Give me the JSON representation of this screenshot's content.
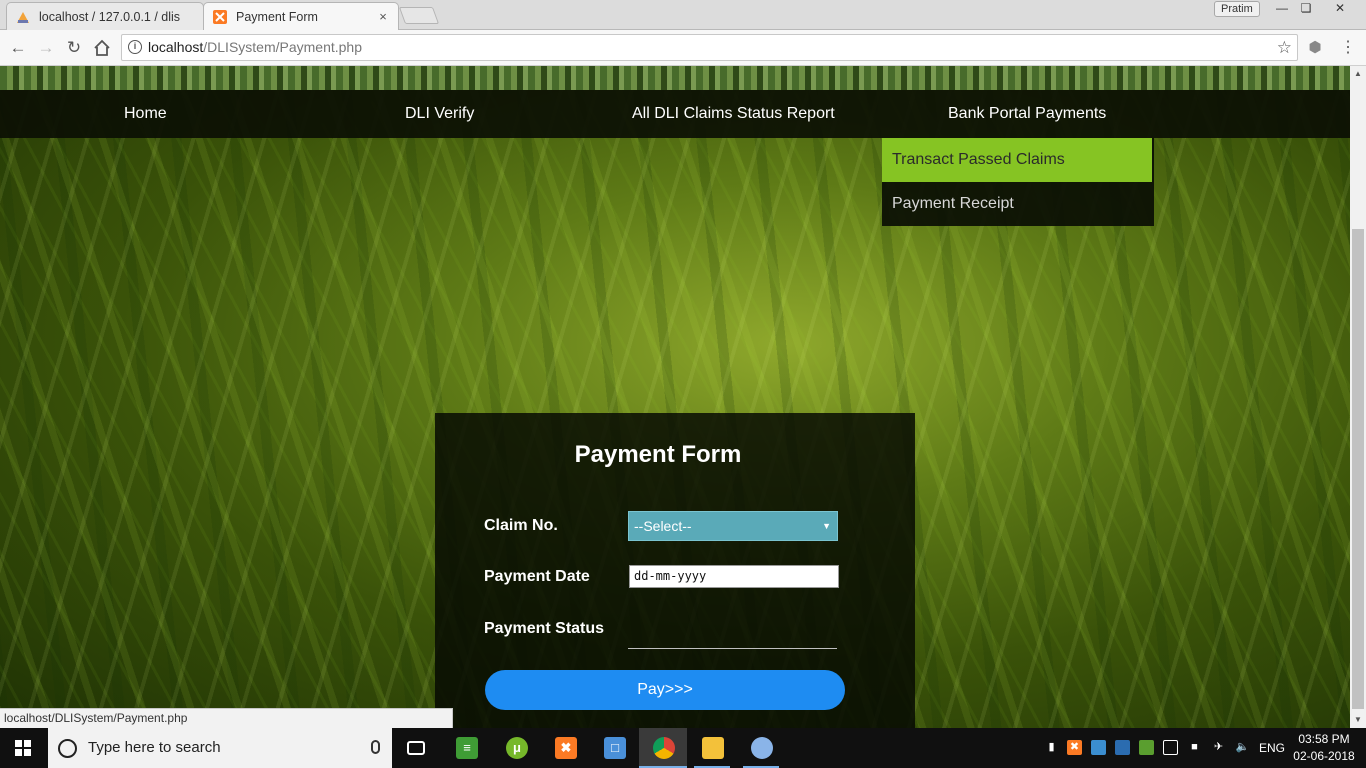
{
  "browser": {
    "tabs": [
      {
        "title": "localhost / 127.0.0.1 / dlis",
        "favicon": "phpmyadmin-icon"
      },
      {
        "title": "Payment Form",
        "favicon": "xampp-icon",
        "active": true
      }
    ],
    "profile": "Pratim",
    "window_controls": {
      "minimize": "—",
      "maximize": "❏",
      "close": "✕"
    },
    "tab_close": "×",
    "url_host": "localhost",
    "url_path": "/DLISystem/Payment.php",
    "status_url": "localhost/DLISystem/Payment.php"
  },
  "nav": {
    "items": [
      "Home",
      "DLI Verify",
      "All DLI Claims Status Report",
      "Bank Portal Payments"
    ],
    "dropdown": [
      {
        "label": "Transact Passed Claims",
        "active": true
      },
      {
        "label": "Payment Receipt",
        "active": false
      }
    ]
  },
  "form": {
    "title": "Payment Form",
    "claim_label": "Claim No.",
    "claim_selected": "--Select--",
    "date_label": "Payment Date",
    "date_placeholder": "dd-mm-yyyy",
    "status_label": "Payment Status",
    "status_value": "",
    "pay_button": "Pay>>>"
  },
  "taskbar": {
    "search_placeholder": "Type here to search",
    "lang": "ENG",
    "time": "03:58 PM",
    "date": "02-06-2018"
  },
  "colors": {
    "nav_bg": "#0c1004",
    "dropdown_active": "#86c423",
    "select_bg": "#5aaab8",
    "pay_button": "#1e8cf2"
  }
}
